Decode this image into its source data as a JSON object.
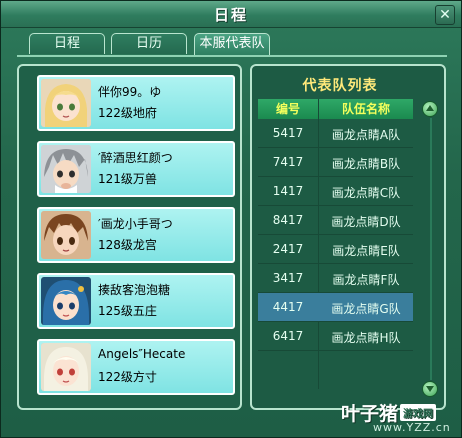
{
  "window": {
    "title": "日程",
    "close_label": "✕"
  },
  "tabs": [
    {
      "label": "日程",
      "active": false
    },
    {
      "label": "日历",
      "active": false
    },
    {
      "label": "本服代表队",
      "active": true
    }
  ],
  "members": [
    {
      "name": "伴你99。ゆ",
      "info": "122级地府",
      "avatar": "blonde-girl-avatar"
    },
    {
      "name": "′醉酒思红颜つ",
      "info": "121级万兽",
      "avatar": "grey-hair-boy-avatar"
    },
    {
      "name": "′画龙小手哥つ",
      "info": "128级龙宫",
      "avatar": "brown-hair-boy-avatar"
    },
    {
      "name": "揍敌客泡泡糖",
      "info": "125级五庄",
      "avatar": "blue-hair-girl-avatar"
    },
    {
      "name": "Angels″Hecate",
      "info": "122级方寸",
      "avatar": "white-hair-girl-avatar"
    }
  ],
  "team_list": {
    "title": "代表队列表",
    "headers": {
      "id": "编号",
      "team": "队伍名称"
    },
    "rows": [
      {
        "id": "5417",
        "team": "画龙点睛A队",
        "selected": false
      },
      {
        "id": "7417",
        "team": "画龙点睛B队",
        "selected": false
      },
      {
        "id": "1417",
        "team": "画龙点睛C队",
        "selected": false
      },
      {
        "id": "8417",
        "team": "画龙点睛D队",
        "selected": false
      },
      {
        "id": "2417",
        "team": "画龙点睛E队",
        "selected": false
      },
      {
        "id": "3417",
        "team": "画龙点睛F队",
        "selected": false
      },
      {
        "id": "4417",
        "team": "画龙点睛G队",
        "selected": true
      },
      {
        "id": "6417",
        "team": "画龙点睛H队",
        "selected": false
      }
    ]
  },
  "watermark": {
    "brand": "叶子猪",
    "badge": "游戏网",
    "url": "www.YZZ.cn"
  },
  "colors": {
    "window_bg": "#23664b",
    "member_card": "#9beeed",
    "list_title": "#ffe97a",
    "header_text": "#f3ff5c",
    "selected_row": "#3a7e9c"
  }
}
